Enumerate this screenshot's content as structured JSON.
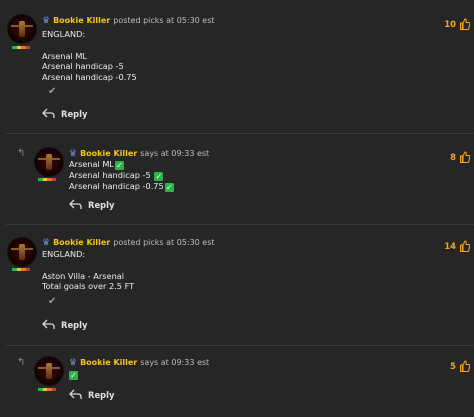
{
  "colors": {
    "background": "#262626",
    "username": "#f5c518",
    "badge": "#6f8fd8",
    "vote": "#f5a623",
    "check": "#2fb24a"
  },
  "posts": [
    {
      "username": "Bookie Killer",
      "action": "posted picks at 05:30 est",
      "lines": [
        "ENGLAND:",
        "",
        "Arsenal ML",
        "Arsenal handicap -5",
        "Arsenal handicap -0.75"
      ],
      "votes": "10",
      "reply_label": "Reply"
    },
    {
      "username": "Bookie Killer",
      "action": "says at 09:33 est",
      "lines": [
        "Arsenal ML",
        "Arsenal handicap -5",
        "Arsenal handicap -0.75"
      ],
      "checks": [
        "✓",
        "✓",
        "✓"
      ],
      "votes": "8",
      "reply_label": "Reply"
    },
    {
      "username": "Bookie Killer",
      "action": "posted picks at 05:30 est",
      "lines": [
        "ENGLAND:",
        "",
        "Aston Villa - Arsenal",
        "Total goals over 2.5 FT"
      ],
      "votes": "14",
      "reply_label": "Reply"
    },
    {
      "username": "Bookie Killer",
      "action": "says at 09:33 est",
      "check": "✓",
      "votes": "5",
      "reply_label": "Reply"
    }
  ],
  "icons": {
    "badge": "rank-badge-icon",
    "thumb": "thumbs-up-icon",
    "reply": "reply-arrow-icon",
    "read_tick": "checkmark-icon",
    "nested": "nested-reply-icon"
  }
}
